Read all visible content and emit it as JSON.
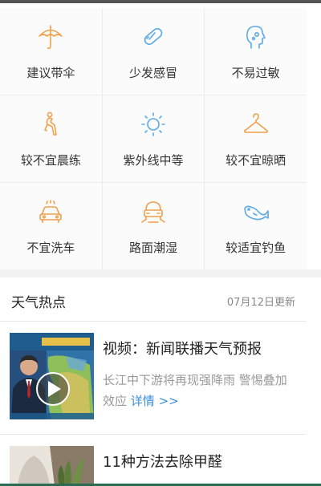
{
  "index_grid": [
    {
      "icon": "umbrella-icon",
      "label": "建议带伞"
    },
    {
      "icon": "pill-icon",
      "label": "少发感冒"
    },
    {
      "icon": "allergy-head-icon",
      "label": "不易过敏"
    },
    {
      "icon": "running-figure-icon",
      "label": "较不宜晨练"
    },
    {
      "icon": "sun-icon",
      "label": "紫外线中等"
    },
    {
      "icon": "hanger-icon",
      "label": "较不宜晾晒"
    },
    {
      "icon": "car-wash-icon",
      "label": "不宜洗车"
    },
    {
      "icon": "road-car-icon",
      "label": "路面潮湿"
    },
    {
      "icon": "fish-icon",
      "label": "较适宜钓鱼"
    }
  ],
  "hot": {
    "title": "天气热点",
    "updated": "07月12日更新"
  },
  "news": [
    {
      "title": "视频：新闻联播天气预报",
      "desc": "长江中下游将再现强降雨 警惕叠加效应",
      "more": "详情 >>",
      "thumb": "news-video-thumbnail"
    },
    {
      "title": "11种方法去除甲醛",
      "thumb": "formaldehyde-article-thumbnail"
    }
  ],
  "colors": {
    "icon_orange": "#f0a04b",
    "icon_blue": "#5aa9e6",
    "link_blue": "#3b8fd6",
    "grid_bg": "#fbfbfb"
  }
}
